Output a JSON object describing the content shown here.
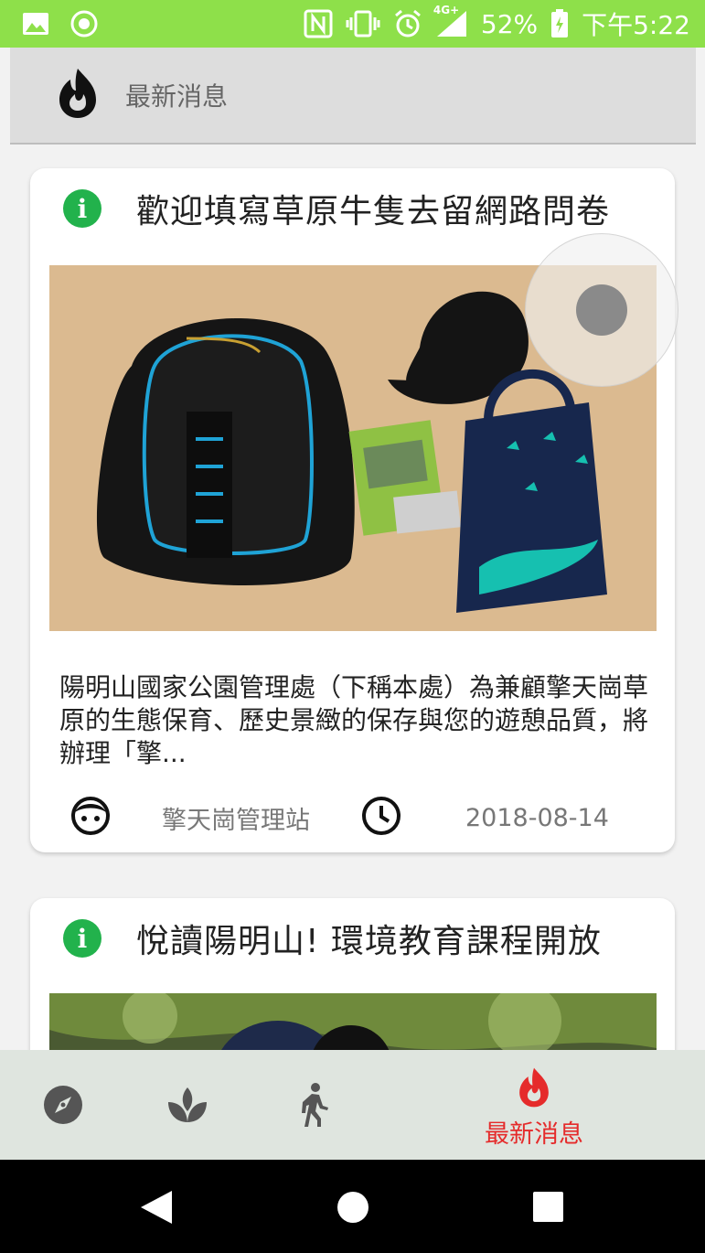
{
  "status_bar": {
    "battery": "52%",
    "network": "4G+",
    "time": "下午5:22",
    "icons": [
      "image-icon",
      "record-icon",
      "nfc-icon",
      "vibrate-icon",
      "alarm-icon",
      "signal-icon",
      "battery-icon"
    ]
  },
  "app_bar": {
    "title": "最新消息",
    "icon": "flame-icon"
  },
  "news": [
    {
      "title": "歡迎填寫草原牛隻去留網路問卷",
      "description": "陽明山國家公園管理處（下稱本處）為兼顧擎天崗草原的生態保育、歷史景緻的保存與您的遊憩品質，將辦理「擎...",
      "author": "擎天崗管理站",
      "date": "2018-08-14"
    },
    {
      "title": "悅讀陽明山! 環境教育課程開放"
    }
  ],
  "bottom_nav": {
    "items": [
      {
        "icon": "compass-icon"
      },
      {
        "icon": "sprout-icon"
      },
      {
        "icon": "walking-icon"
      },
      {
        "icon": "flame-icon",
        "label": "最新消息",
        "active": true
      }
    ],
    "active_color": "#e52b2b"
  },
  "colors": {
    "status_bar": "#8ee04a",
    "info_icon": "#22b24c",
    "accent": "#e52b2b"
  }
}
